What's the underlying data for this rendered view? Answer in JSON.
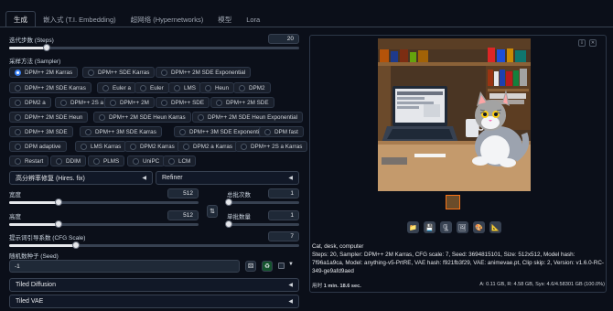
{
  "tabs": [
    "生成",
    "嵌入式 (T.I. Embedding)",
    "超网络 (Hypernetworks)",
    "模型",
    "Lora"
  ],
  "steps": {
    "label": "迭代步数 (Steps)",
    "value": "20",
    "fraction": 0.13
  },
  "sampler": {
    "label": "采样方法 (Sampler)",
    "selected": "DPM++ 2M Karras",
    "options": [
      "DPM++ 2M Karras",
      "DPM++ SDE Karras",
      "DPM++ 2M SDE Exponential",
      "DPM++ 2M SDE Karras",
      "Euler a",
      "Euler",
      "LMS",
      "Heun",
      "DPM2",
      "DPM2 a",
      "DPM++ 2S a",
      "DPM++ 2M",
      "DPM++ SDE",
      "DPM++ 2M SDE",
      "DPM++ 2M SDE Heun",
      "DPM++ 2M SDE Heun Karras",
      "DPM++ 2M SDE Heun Exponential",
      "DPM++ 3M SDE",
      "DPM++ 3M SDE Karras",
      "DPM++ 3M SDE Exponential",
      "DPM fast",
      "DPM adaptive",
      "LMS Karras",
      "DPM2 Karras",
      "DPM2 a Karras",
      "DPM++ 2S a Karras",
      "Restart",
      "DDIM",
      "PLMS",
      "UniPC",
      "LCM"
    ]
  },
  "hires": {
    "label": "高分辨率修复 (Hires. fix)"
  },
  "refiner": {
    "label": "Refiner"
  },
  "width": {
    "label": "宽度",
    "value": "512",
    "fraction": 0.25
  },
  "height": {
    "label": "高度",
    "value": "512",
    "fraction": 0.25
  },
  "batch_count": {
    "label": "总批次数",
    "value": "1",
    "fraction": 0.0
  },
  "batch_size": {
    "label": "单批数量",
    "value": "1",
    "fraction": 0.0
  },
  "cfg": {
    "label": "提示词引导系数 (CFG Scale)",
    "value": "7",
    "fraction": 0.23
  },
  "seed": {
    "label": "随机数种子 (Seed)",
    "value": "-1"
  },
  "tiled_diffusion": {
    "label": "Tiled Diffusion"
  },
  "tiled_vae": {
    "label": "Tiled VAE"
  },
  "output": {
    "prompt": "Cat, desk, computer",
    "params": "Steps: 20, Sampler: DPM++ 2M Karras, CFG scale: 7, Seed: 3694815101, Size: 512x512, Model hash: 7f96a1a9ca, Model: anything-v5-PrtRE, VAE hash: f921fb3f29, VAE: animevae.pt, Clip skip: 2, Version: v1.6.0-RC-349-ge9afd9aed",
    "time_label": "用时",
    "time": "1 min. 18.6 sec.",
    "mem_a": "A: 0.11 GB",
    "mem_r": "R: 4.58 GB",
    "mem_sys": "Sys: 4.6/4.58301 GB",
    "mem_pct": "(100.0%)"
  },
  "colors": {
    "accent": "#f97316",
    "bg": "#0b0f19",
    "panel": "#1f2937"
  }
}
